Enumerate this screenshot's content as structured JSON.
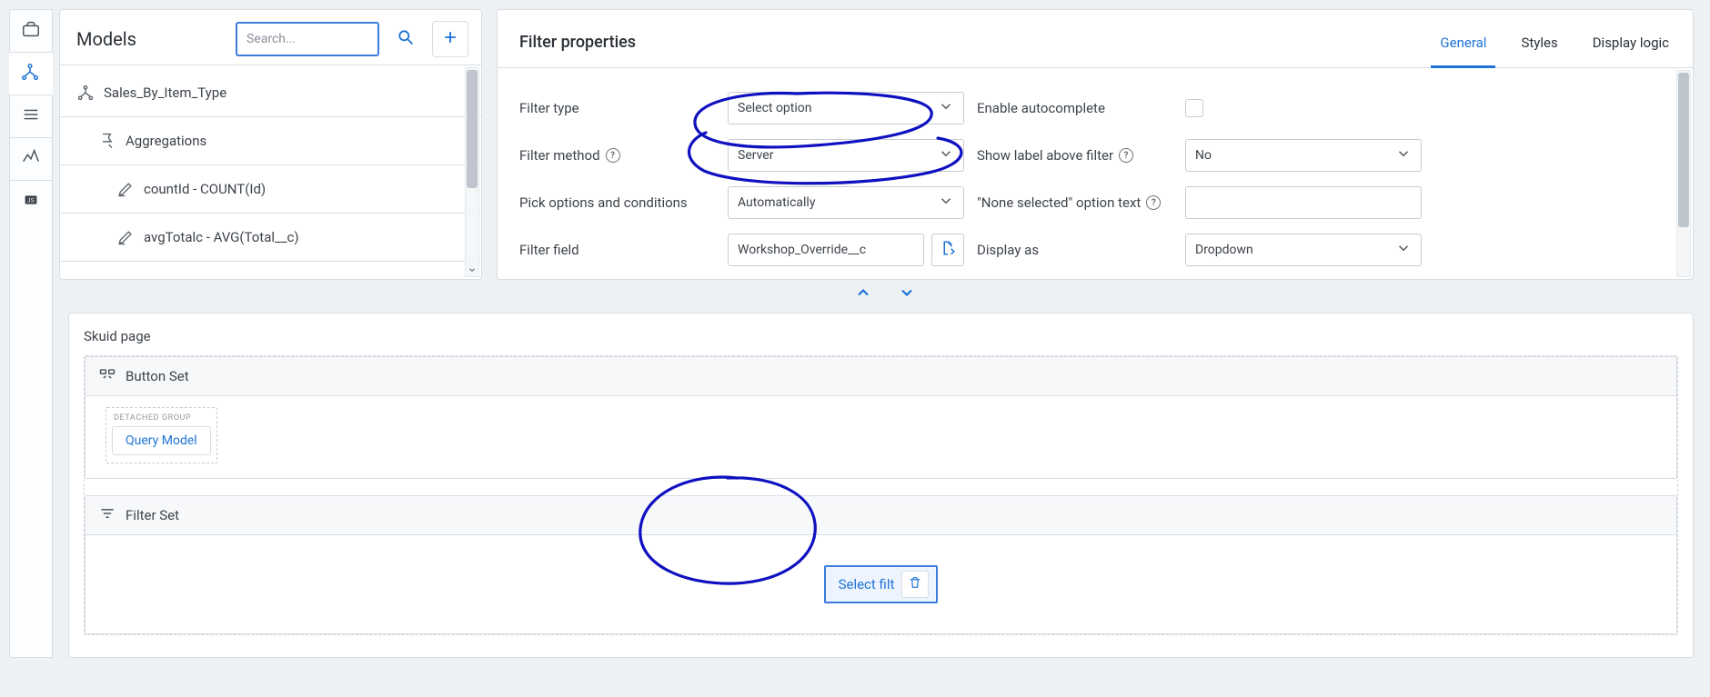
{
  "rail": {
    "items": [
      {
        "name": "briefcase-icon",
        "active": false
      },
      {
        "name": "model-tree-icon",
        "active": true
      },
      {
        "name": "list-icon",
        "active": false
      },
      {
        "name": "analytics-icon",
        "active": false
      },
      {
        "name": "js-icon",
        "active": false
      }
    ]
  },
  "models": {
    "title": "Models",
    "search_placeholder": "Search...",
    "tree": {
      "model_name": "Sales_By_Item_Type",
      "group_label": "Aggregations",
      "fields": [
        "countId - COUNT(Id)",
        "avgTotalc - AVG(Total__c)"
      ]
    }
  },
  "props": {
    "title": "Filter properties",
    "tabs": [
      "General",
      "Styles",
      "Display logic"
    ],
    "active_tab": "General",
    "labels": {
      "filter_type": "Filter type",
      "filter_method": "Filter method",
      "pick_options": "Pick options and conditions",
      "filter_field": "Filter field",
      "enable_autocomplete": "Enable autocomplete",
      "show_label": "Show label above filter",
      "none_selected": "\"None selected\" option text",
      "display_as": "Display as"
    },
    "values": {
      "filter_type": "Select option",
      "filter_method": "Server",
      "pick_options": "Automatically",
      "filter_field": "Workshop_Override__c",
      "enable_autocomplete": false,
      "show_label": "No",
      "none_selected": "",
      "display_as": "Dropdown"
    }
  },
  "preview": {
    "title": "Skuid page",
    "button_set_label": "Button Set",
    "detached_group_title": "DETACHED GROUP",
    "query_model_label": "Query Model",
    "filter_set_label": "Filter Set",
    "filter_chip_label": "Select filt"
  }
}
